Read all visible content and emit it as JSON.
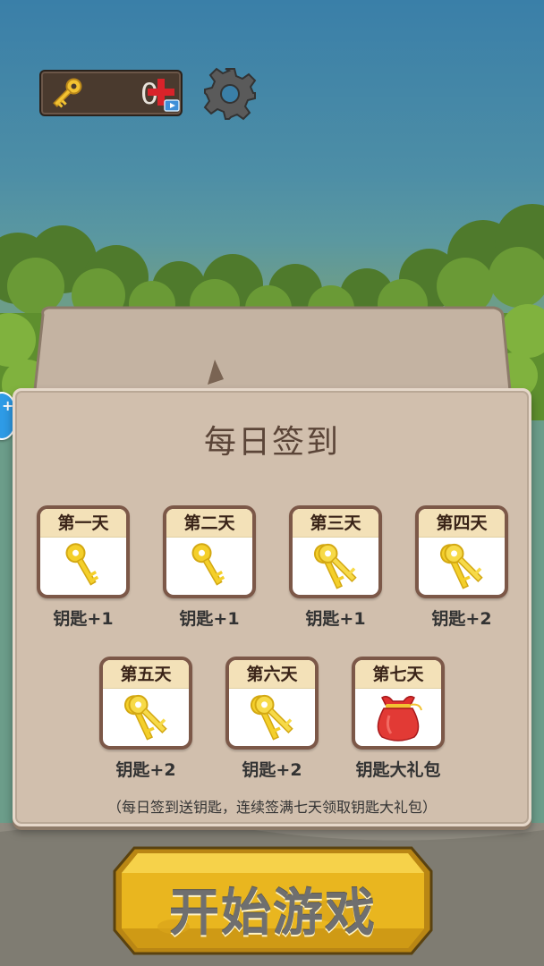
{
  "hud": {
    "key_count": "0",
    "key_icon": "key-icon",
    "add_icon": "plus-video-icon",
    "settings_icon": "gear-icon"
  },
  "side_bubble": {
    "label": "+"
  },
  "dialog": {
    "title": "每日签到",
    "days": [
      {
        "label": "第一天",
        "reward": "钥匙+1",
        "icon": "single-key-icon"
      },
      {
        "label": "第二天",
        "reward": "钥匙+1",
        "icon": "single-key-icon"
      },
      {
        "label": "第三天",
        "reward": "钥匙+1",
        "icon": "key-bunch-icon"
      },
      {
        "label": "第四天",
        "reward": "钥匙+2",
        "icon": "key-bunch-icon"
      },
      {
        "label": "第五天",
        "reward": "钥匙+2",
        "icon": "key-bunch-icon"
      },
      {
        "label": "第六天",
        "reward": "钥匙+2",
        "icon": "key-bunch-icon"
      },
      {
        "label": "第七天",
        "reward": "钥匙大礼包",
        "icon": "red-gift-bag-icon"
      }
    ],
    "footnote": "（每日签到送钥匙，连续签满七天领取钥匙大礼包）"
  },
  "start_button": {
    "label": "开始游戏"
  },
  "colors": {
    "sky": "#3a7fa8",
    "panel": "#d1bfad",
    "card_border": "#7c5848",
    "card_header": "#f3e1b8",
    "button_gold": "#e9b61f",
    "add_red": "#d8232a"
  }
}
